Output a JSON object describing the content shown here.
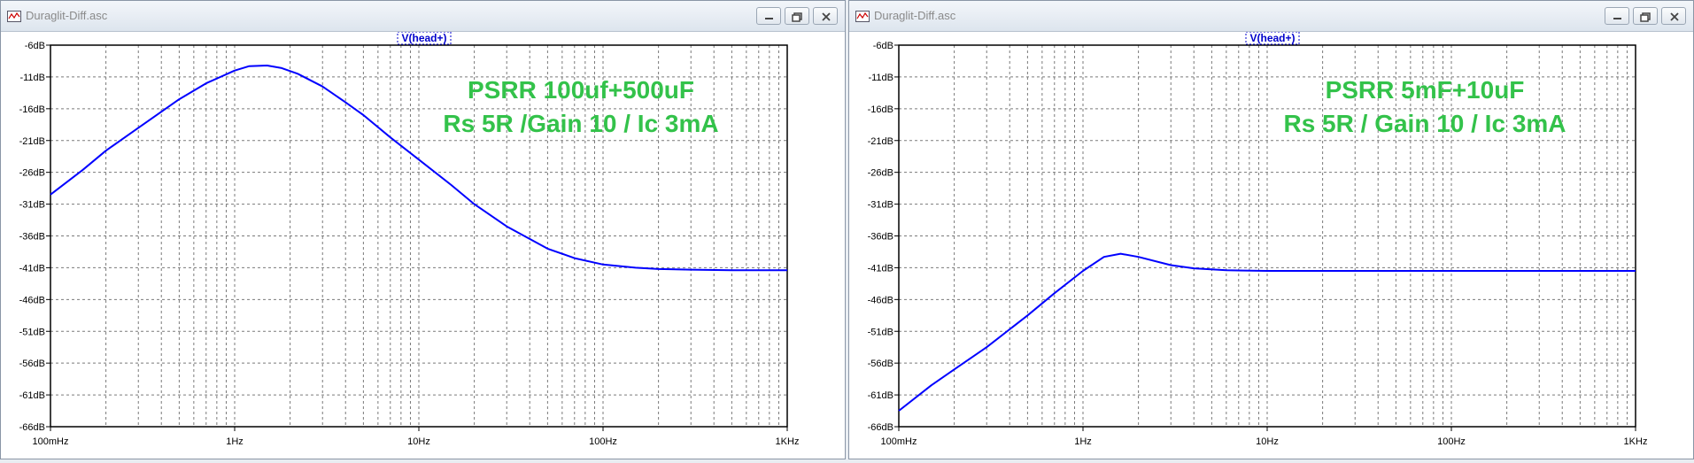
{
  "windows": [
    {
      "title": "Duraglit-Diff.asc",
      "trace_label": "V(head+)",
      "annotation": [
        "PSRR 100uf+500uF",
        "Rs 5R /Gain 10 / Ic 3mA"
      ],
      "y_ticks": [
        "-6dB",
        "-11dB",
        "-16dB",
        "-21dB",
        "-26dB",
        "-31dB",
        "-36dB",
        "-41dB",
        "-46dB",
        "-51dB",
        "-56dB",
        "-61dB",
        "-66dB"
      ],
      "x_ticks": [
        "100mHz",
        "1Hz",
        "10Hz",
        "100Hz",
        "1KHz"
      ]
    },
    {
      "title": "Duraglit-Diff.asc",
      "trace_label": "V(head+)",
      "annotation": [
        "PSRR 5mF+10uF",
        "Rs 5R / Gain 10 / Ic 3mA"
      ],
      "y_ticks": [
        "-6dB",
        "-11dB",
        "-16dB",
        "-21dB",
        "-26dB",
        "-31dB",
        "-36dB",
        "-41dB",
        "-46dB",
        "-51dB",
        "-56dB",
        "-61dB",
        "-66dB"
      ],
      "x_ticks": [
        "100mHz",
        "1Hz",
        "10Hz",
        "100Hz",
        "1KHz"
      ]
    }
  ],
  "colors": {
    "trace": "#0000ff",
    "annotation": "#33c24a",
    "grid": "#7a7a7a",
    "trace_label": "#0000cc"
  },
  "chart_data": [
    {
      "type": "line",
      "x_scale": "log",
      "xlim": [
        0.1,
        1000
      ],
      "ylim": [
        -66,
        -6
      ],
      "grid": true,
      "series": [
        {
          "name": "V(head+)",
          "x": [
            0.1,
            0.15,
            0.2,
            0.3,
            0.5,
            0.7,
            1,
            1.2,
            1.5,
            1.8,
            2.2,
            3,
            4,
            5,
            7,
            10,
            15,
            20,
            30,
            50,
            70,
            100,
            150,
            200,
            300,
            500,
            1000
          ],
          "y": [
            -29.5,
            -25.6,
            -22.6,
            -19,
            -14.5,
            -12,
            -10,
            -9.3,
            -9.2,
            -9.6,
            -10.5,
            -12.5,
            -15,
            -17,
            -20.5,
            -24,
            -28,
            -31,
            -34.5,
            -38,
            -39.5,
            -40.5,
            -41,
            -41.2,
            -41.3,
            -41.4,
            -41.4
          ]
        }
      ]
    },
    {
      "type": "line",
      "x_scale": "log",
      "xlim": [
        0.1,
        1000
      ],
      "ylim": [
        -66,
        -6
      ],
      "grid": true,
      "series": [
        {
          "name": "V(head+)",
          "x": [
            0.1,
            0.15,
            0.2,
            0.3,
            0.5,
            0.7,
            1,
            1.3,
            1.6,
            2,
            3,
            4,
            6,
            10,
            20,
            50,
            100,
            300,
            1000
          ],
          "y": [
            -63.5,
            -59.5,
            -57,
            -53.5,
            -48.5,
            -45,
            -41.5,
            -39.3,
            -38.8,
            -39.3,
            -40.6,
            -41.1,
            -41.4,
            -41.5,
            -41.5,
            -41.5,
            -41.5,
            -41.5,
            -41.5
          ]
        }
      ]
    }
  ]
}
